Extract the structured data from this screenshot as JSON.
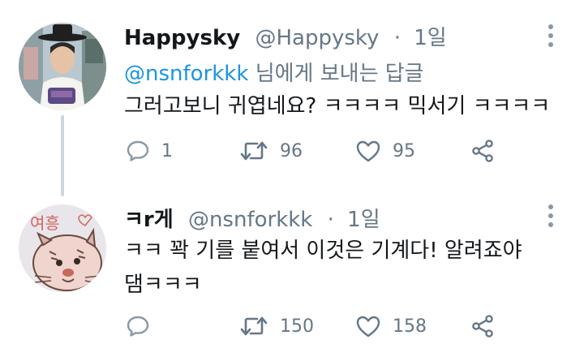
{
  "tweet1": {
    "name": "Happysky",
    "handle": "@Happysky",
    "dot": "·",
    "time": "1일",
    "reply_prefix": "",
    "reply_mention": "@nsnforkkk",
    "reply_suffix": " 님에게 보내는 답글",
    "text": "그러고보니 귀엽네요? ㅋㅋㅋㅋ 믹서기 ㅋㅋㅋㅋ",
    "reply_count": "1",
    "retweet_count": "96",
    "like_count": "95"
  },
  "tweet2": {
    "name": "ㅋr게",
    "handle": "@nsnforkkk",
    "dot": "·",
    "time": "1일",
    "text": "ㅋㅋ 꽉 기를 붙여서 이것은 기계다! 알려죠야 댐ㅋㅋㅋ",
    "avatar_text": "여흥",
    "reply_count": "",
    "retweet_count": "150",
    "like_count": "158"
  },
  "colors": {
    "text": "#14171a",
    "secondary": "#657786",
    "link": "#1b95e0",
    "thread_line": "#ccd6dd"
  },
  "icons": [
    "reply-icon",
    "retweet-icon",
    "like-icon",
    "share-icon",
    "more-options-icon"
  ]
}
